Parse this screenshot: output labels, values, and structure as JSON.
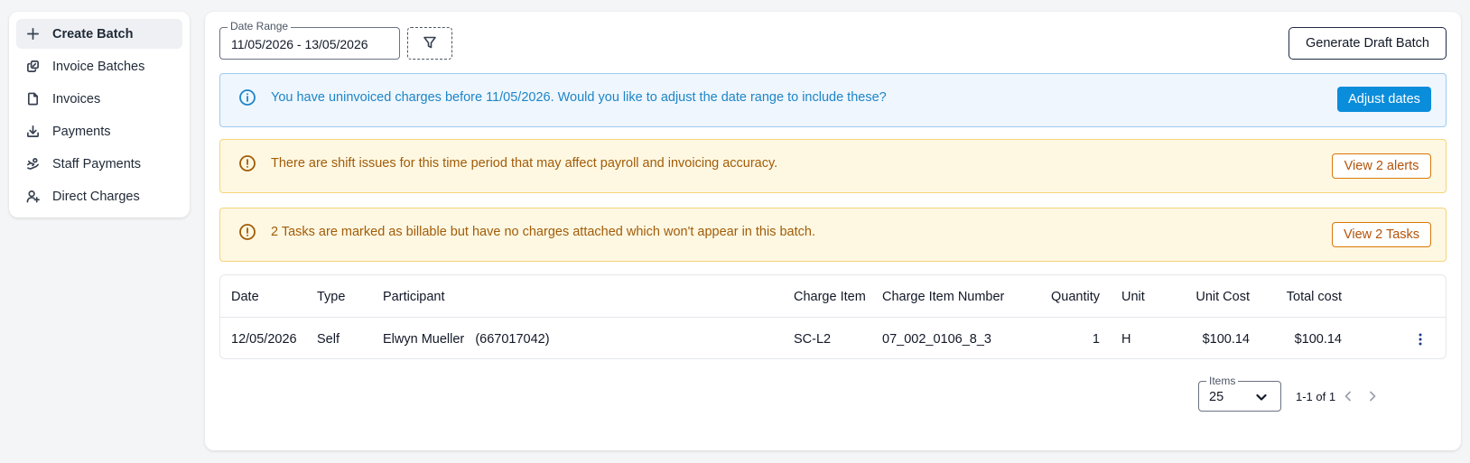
{
  "sidebar": {
    "items": [
      {
        "label": "Create Batch",
        "icon": "plus-icon"
      },
      {
        "label": "Invoice Batches",
        "icon": "stack-icon"
      },
      {
        "label": "Invoices",
        "icon": "document-icon"
      },
      {
        "label": "Payments",
        "icon": "download-icon"
      },
      {
        "label": "Staff Payments",
        "icon": "hand-coin-icon"
      },
      {
        "label": "Direct Charges",
        "icon": "user-plus-icon"
      }
    ]
  },
  "toolbar": {
    "date_range_label": "Date Range",
    "date_range_value": "11/05/2026 - 13/05/2026",
    "generate_label": "Generate Draft Batch"
  },
  "alerts": [
    {
      "type": "info",
      "text": "You have uninvoiced charges before 11/05/2026. Would you like to adjust the date range to include these?",
      "button": "Adjust dates"
    },
    {
      "type": "warning",
      "text": "There are shift issues for this time period that may affect payroll and invoicing accuracy.",
      "button": "View 2 alerts"
    },
    {
      "type": "warning",
      "text": "2 Tasks are marked as billable but have no charges attached which won't appear in this batch.",
      "button": "View 2 Tasks"
    }
  ],
  "table": {
    "headers": [
      "Date",
      "Type",
      "Participant",
      "Charge Item",
      "Charge Item Number",
      "Quantity",
      "Unit",
      "Unit Cost",
      "Total cost"
    ],
    "rows": [
      [
        "12/05/2026",
        "Self",
        "Elwyn Mueller   (667017042)",
        "SC-L2",
        "07_002_0106_8_3",
        "1",
        "H",
        "$100.14",
        "$100.14"
      ]
    ]
  },
  "pagination": {
    "items_label": "Items",
    "items_value": "25",
    "range": "1-1 of 1"
  },
  "colors": {
    "info_accent": "#1d85c8",
    "warning_accent": "#a15c07",
    "primary_button": "#0a8ddb"
  }
}
